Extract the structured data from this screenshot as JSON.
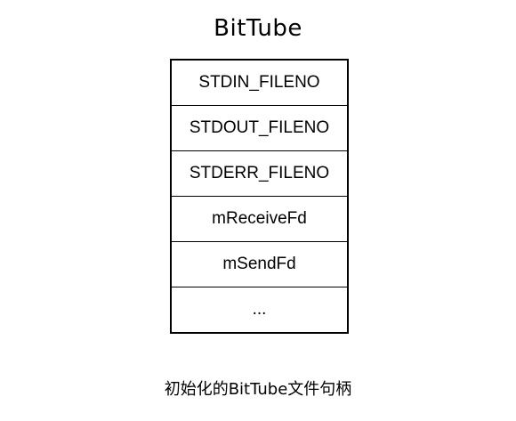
{
  "title": "BitTube",
  "rows": [
    "STDIN_FILENO",
    "STDOUT_FILENO",
    "STDERR_FILENO",
    "mReceiveFd",
    "mSendFd",
    "..."
  ],
  "caption": "初始化的BitTube文件句柄"
}
